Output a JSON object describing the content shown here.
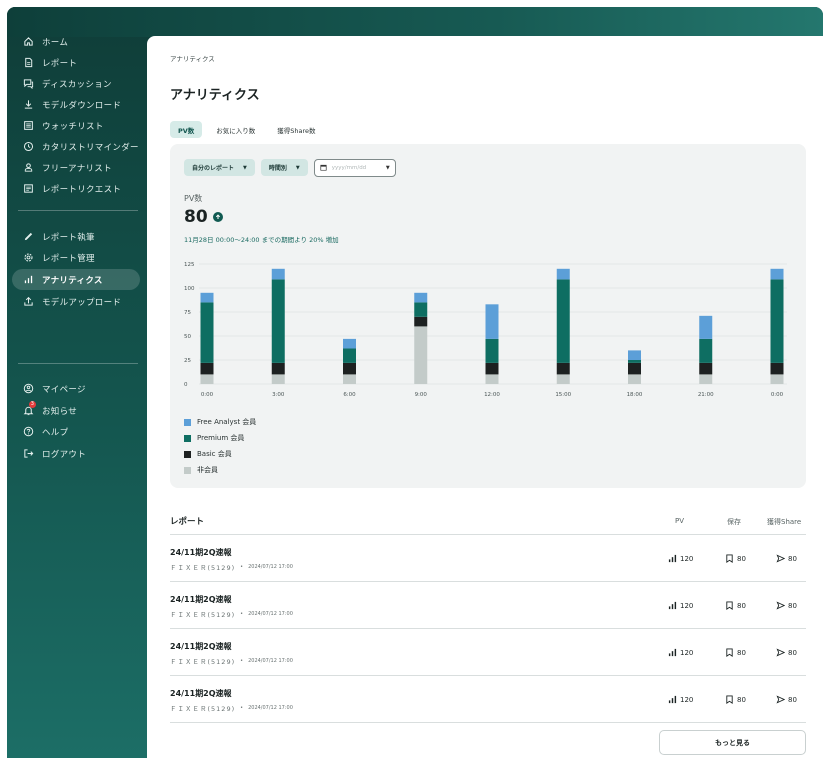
{
  "sidebar": {
    "items": [
      {
        "label": "ホーム",
        "icon": "home-icon"
      },
      {
        "label": "レポート",
        "icon": "document-icon"
      },
      {
        "label": "ディスカッション",
        "icon": "chat-icon"
      },
      {
        "label": "モデルダウンロード",
        "icon": "download-icon"
      },
      {
        "label": "ウォッチリスト",
        "icon": "list-icon"
      },
      {
        "label": "カタリストリマインダー",
        "icon": "clock-icon"
      },
      {
        "label": "フリーアナリスト",
        "icon": "person-icon"
      },
      {
        "label": "レポートリクエスト",
        "icon": "request-icon"
      }
    ],
    "writer_items": [
      {
        "label": "レポート執筆",
        "icon": "pencil-icon"
      },
      {
        "label": "レポート管理",
        "icon": "gear-icon"
      },
      {
        "label": "アナリティクス",
        "icon": "bar-chart-icon",
        "active": true
      },
      {
        "label": "モデルアップロード",
        "icon": "upload-icon"
      }
    ],
    "account_items": [
      {
        "label": "マイページ",
        "icon": "user-circle-icon"
      },
      {
        "label": "お知らせ",
        "icon": "bell-icon",
        "badge": "3"
      },
      {
        "label": "ヘルプ",
        "icon": "help-icon"
      },
      {
        "label": "ログアウト",
        "icon": "logout-icon"
      }
    ]
  },
  "breadcrumb": "アナリティクス",
  "page_title": "アナリティクス",
  "tabs": [
    "PV数",
    "お気に入り数",
    "獲得Share数"
  ],
  "filters": {
    "report": "自分のレポート",
    "period": "時間別",
    "date_placeholder": "yyyy/mm/dd"
  },
  "metric": {
    "label": "PV数",
    "value": "80",
    "note": "11月28日 00:00〜24:00 までの期間より 20% 増加"
  },
  "colors": {
    "free_analyst": "#5c9fd8",
    "premium": "#0e6e62",
    "basic": "#1d2121",
    "non_member": "#c3cbc9",
    "accent": "#12564f"
  },
  "chart_data": {
    "type": "bar",
    "stacked": true,
    "categories": [
      "0:00",
      "",
      "3:00",
      "",
      "6:00",
      "",
      "9:00",
      "",
      "12:00",
      "",
      "15:00",
      "",
      "18:00",
      "",
      "21:00",
      "",
      "0:00"
    ],
    "x_tick_labels": [
      "0:00",
      "3:00",
      "6:00",
      "9:00",
      "12:00",
      "15:00",
      "18:00",
      "21:00",
      "0:00"
    ],
    "bar_categories": [
      "0:00",
      "3:00",
      "6:00",
      "9:00",
      "12:00",
      "15:00",
      "18:00",
      "21:00",
      "0:00"
    ],
    "series": [
      {
        "name": "非会員",
        "values": [
          10,
          10,
          10,
          60,
          10,
          10,
          10,
          10,
          10
        ]
      },
      {
        "name": "Basic 会員",
        "values": [
          12,
          12,
          12,
          10,
          12,
          12,
          12,
          12,
          12
        ]
      },
      {
        "name": "Premium 会員",
        "values": [
          63,
          87,
          15,
          15,
          25,
          87,
          3,
          25,
          87
        ]
      },
      {
        "name": "Free Analyst 会員",
        "values": [
          10,
          11,
          10,
          10,
          36,
          11,
          10,
          24,
          11
        ]
      }
    ],
    "yticks": [
      0,
      25,
      50,
      75,
      100,
      125
    ],
    "ylim": [
      0,
      125
    ],
    "grid": true,
    "legend_position": "bottom-left"
  },
  "legend": [
    "Free Analyst 会員",
    "Premium 会員",
    "Basic 会員",
    "非会員"
  ],
  "table": {
    "title": "レポート",
    "columns": [
      "PV",
      "保存",
      "獲得Share"
    ],
    "rows": [
      {
        "title": "24/11期2Q速報",
        "company": "ＦＩＸＥＲ(5129)",
        "date": "2024/07/12 17:00",
        "pv": "120",
        "saves": "80",
        "shares": "80"
      },
      {
        "title": "24/11期2Q速報",
        "company": "ＦＩＸＥＲ(5129)",
        "date": "2024/07/12 17:00",
        "pv": "120",
        "saves": "80",
        "shares": "80"
      },
      {
        "title": "24/11期2Q速報",
        "company": "ＦＩＸＥＲ(5129)",
        "date": "2024/07/12 17:00",
        "pv": "120",
        "saves": "80",
        "shares": "80"
      },
      {
        "title": "24/11期2Q速報",
        "company": "ＦＩＸＥＲ(5129)",
        "date": "2024/07/12 17:00",
        "pv": "120",
        "saves": "80",
        "shares": "80"
      }
    ],
    "more_label": "もっと見る"
  }
}
